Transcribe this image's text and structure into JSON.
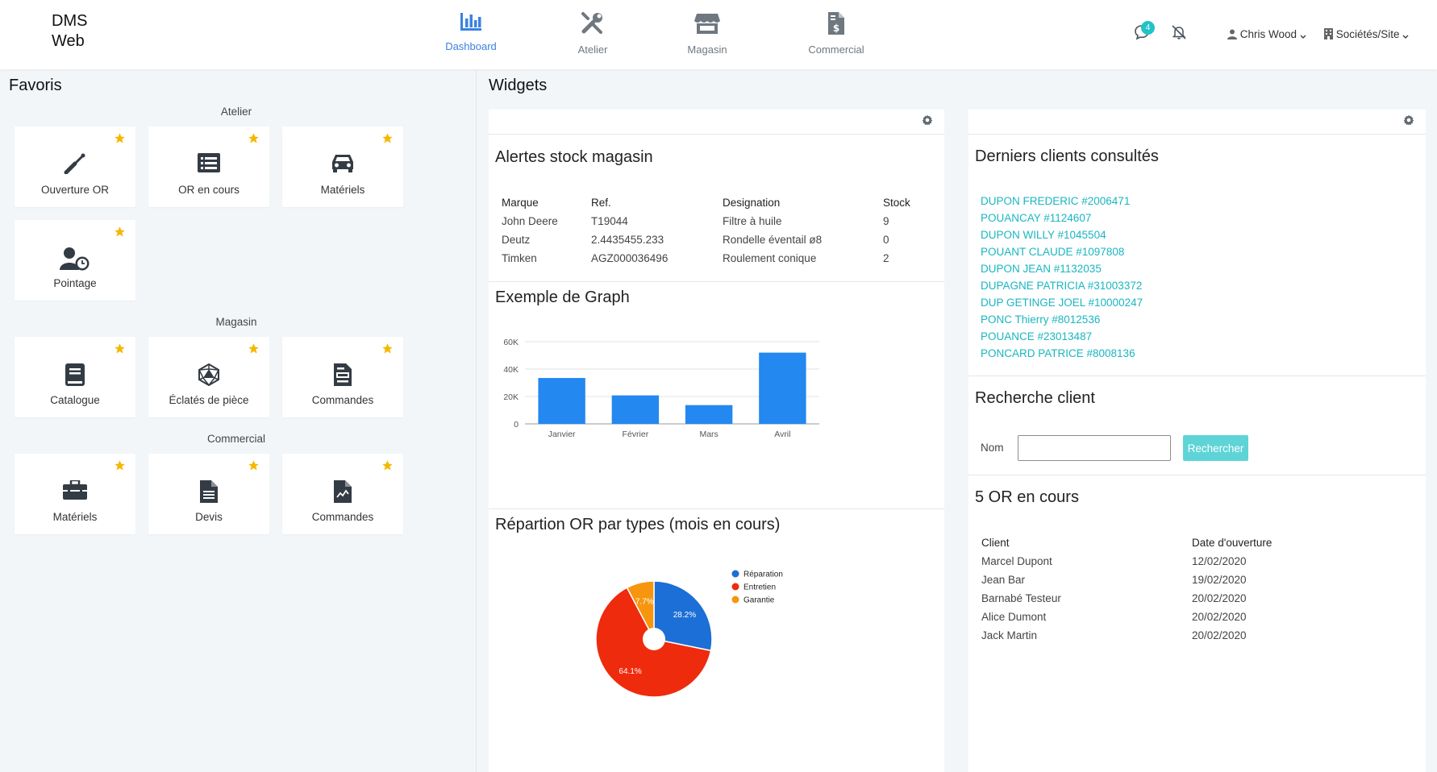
{
  "brand": {
    "line1": "DMS",
    "line2": "Web"
  },
  "nav": [
    {
      "label": "Dashboard",
      "icon": "chart-bar-icon",
      "active": true
    },
    {
      "label": "Atelier",
      "icon": "tools-icon",
      "active": false
    },
    {
      "label": "Magasin",
      "icon": "store-icon",
      "active": false
    },
    {
      "label": "Commercial",
      "icon": "invoice-dollar-icon",
      "active": false
    }
  ],
  "header": {
    "notifications_count": "4",
    "user_name": "Chris Wood",
    "site_menu": "Sociétés/Site"
  },
  "favoris": {
    "title": "Favoris",
    "sections": [
      {
        "label": "Atelier",
        "tiles": [
          {
            "label": "Ouverture OR",
            "icon": "wrench-screwdriver-icon"
          },
          {
            "label": "OR en cours",
            "icon": "list-icon"
          },
          {
            "label": "Matériels",
            "icon": "car-icon"
          },
          {
            "label": "Pointage",
            "icon": "user-clock-icon"
          }
        ]
      },
      {
        "label": "Magasin",
        "tiles": [
          {
            "label": "Catalogue",
            "icon": "book-icon"
          },
          {
            "label": "Éclatés de pièce",
            "icon": "dice-d20-icon"
          },
          {
            "label": "Commandes",
            "icon": "document-icon"
          }
        ]
      },
      {
        "label": "Commercial",
        "tiles": [
          {
            "label": "Matériels",
            "icon": "toolbox-icon"
          },
          {
            "label": "Devis",
            "icon": "file-text-icon"
          },
          {
            "label": "Commandes",
            "icon": "file-chart-icon"
          }
        ]
      }
    ]
  },
  "widgets": {
    "title": "Widgets",
    "stock": {
      "title": "Alertes stock magasin",
      "columns": [
        "Marque",
        "Ref.",
        "Designation",
        "Stock"
      ],
      "rows": [
        [
          "John Deere",
          "T19044",
          "Filtre à huile",
          "9"
        ],
        [
          "Deutz",
          "2.4435455.233",
          "Rondelle éventail ø8",
          "0"
        ],
        [
          "Timken",
          "AGZ000036496",
          "Roulement conique",
          "2"
        ]
      ]
    },
    "graph": {
      "title": "Exemple de Graph"
    },
    "pie": {
      "title": "Répartion OR par types (mois en cours)"
    },
    "clients": {
      "title": "Derniers clients consultés",
      "items": [
        "DUPON FREDERIC #2006471",
        "POUANCAY #1124607",
        "DUPON WILLY #1045504",
        "POUANT CLAUDE #1097808",
        "DUPON JEAN #1132035",
        "DUPAGNE PATRICIA #31003372",
        "DUP GETINGE JOEL #10000247",
        "PONC Thierry #8012536",
        "POUANCE #23013487",
        "PONCARD PATRICE #8008136"
      ]
    },
    "search": {
      "title": "Recherche client",
      "label": "Nom",
      "value": "",
      "button": "Rechercher"
    },
    "or_en_cours": {
      "title": "5 OR en cours",
      "columns": [
        "Client",
        "Date d'ouverture"
      ],
      "rows": [
        [
          "Marcel Dupont",
          "12/02/2020"
        ],
        [
          "Jean Bar",
          "19/02/2020"
        ],
        [
          "Barnabé Testeur",
          "20/02/2020"
        ],
        [
          "Alice Dumont",
          "20/02/2020"
        ],
        [
          "Jack Martin",
          "20/02/2020"
        ]
      ]
    }
  },
  "colors": {
    "accent": "#3b82e0",
    "star": "#f5b800",
    "link": "#1ab6c1",
    "bar": "#2388f0"
  },
  "chart_data": [
    {
      "type": "bar",
      "title": "Exemple de Graph",
      "categories": [
        "Janvier",
        "Février",
        "Mars",
        "Avril"
      ],
      "values": [
        33500,
        20800,
        13700,
        52000
      ],
      "ylim": [
        0,
        60000
      ],
      "yticks": [
        "0",
        "20K",
        "40K",
        "60K"
      ],
      "grid": true
    },
    {
      "type": "pie",
      "title": "Répartion OR par types (mois en cours)",
      "series": [
        {
          "name": "Réparation",
          "value": 28.2,
          "label": "28.2%",
          "color": "#1c6fd6"
        },
        {
          "name": "Entretien",
          "value": 64.1,
          "label": "64.1%",
          "color": "#ef2b0d"
        },
        {
          "name": "Garantie",
          "value": 7.7,
          "label": "7.7%",
          "color": "#f7960e"
        }
      ],
      "legend": "right"
    }
  ]
}
